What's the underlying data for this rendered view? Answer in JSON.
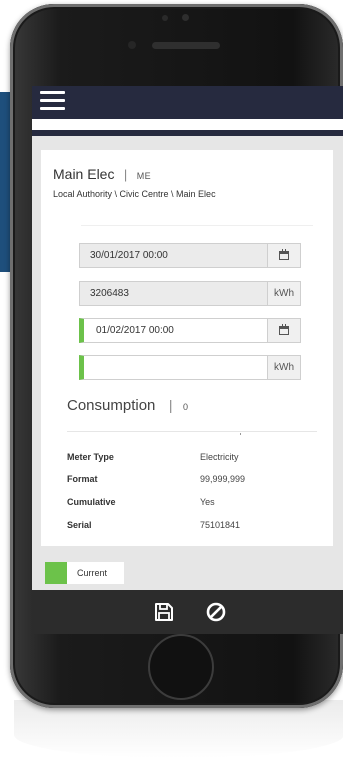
{
  "meter": {
    "name": "Main Elec",
    "code": "ME",
    "path": "Local Authority \\ Civic Centre \\ Main Elec"
  },
  "readings": {
    "previous_date": "30/01/2017 00:00",
    "previous_value": "3206483",
    "previous_unit": "kWh",
    "new_date": "01/02/2017 00:00",
    "new_value": "",
    "new_unit": "kWh"
  },
  "consumption": {
    "label": "Consumption",
    "value": "0"
  },
  "properties": [
    {
      "label": "Meter Type",
      "value": "Electricity"
    },
    {
      "label": "Format",
      "value": "99,999,999"
    },
    {
      "label": "Cumulative",
      "value": "Yes"
    },
    {
      "label": "Serial",
      "value": "75101841"
    }
  ],
  "legend": {
    "label": "Current",
    "color": "#6cc24a"
  },
  "icons": {
    "menu": "hamburger-menu-icon",
    "calendar": "calendar-icon",
    "save": "floppy-disk-icon",
    "cancel": "cancel-icon"
  },
  "colors": {
    "nav": "#262a3f",
    "accent": "#6cc24a",
    "footer": "#2c2c2c",
    "page_background": "#1e4f7c"
  }
}
